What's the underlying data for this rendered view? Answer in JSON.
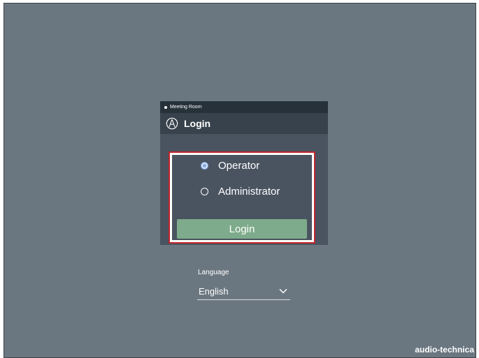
{
  "dialog": {
    "room_name": "Meeting Room",
    "title": "Login",
    "options": [
      {
        "label": "Operator",
        "selected": true
      },
      {
        "label": "Administrator",
        "selected": false
      }
    ],
    "login_button_label": "Login",
    "highlight_color": "#c0242b",
    "accent_color": "#7eab8b"
  },
  "language": {
    "label": "Language",
    "selected": "English"
  },
  "brand": "audio-technica",
  "icons": {
    "logo": "audio-technica-logo-icon",
    "dropdown": "chevron-down-icon",
    "status": "status-dot-icon"
  }
}
